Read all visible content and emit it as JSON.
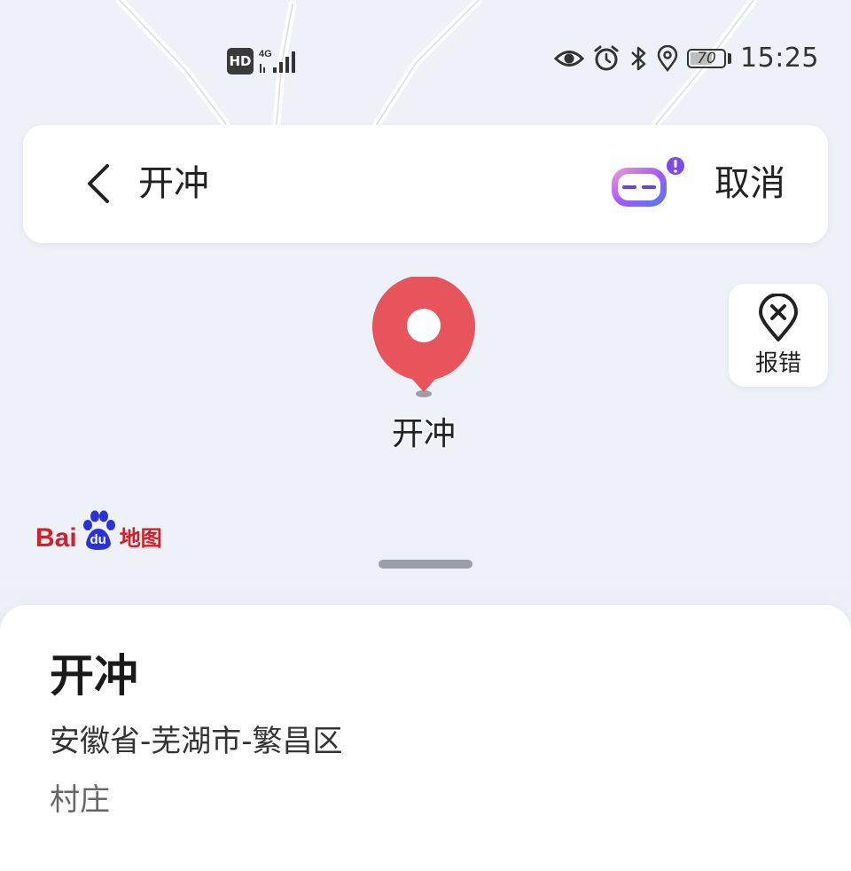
{
  "status_bar": {
    "hd": "HD",
    "network": "4G",
    "battery": "70",
    "time": "15:25"
  },
  "search": {
    "query": "开冲",
    "cancel_label": "取消"
  },
  "map": {
    "report_label": "报错",
    "marker_label": "开冲",
    "logo_bai": "Bai",
    "logo_du": "du",
    "logo_map": "地图"
  },
  "place": {
    "name": "开冲",
    "address": "安徽省-芜湖市-繁昌区",
    "category": "村庄"
  },
  "colors": {
    "marker": "#e8545c",
    "brand_red": "#d0202a",
    "brand_blue": "#2a32d8"
  }
}
